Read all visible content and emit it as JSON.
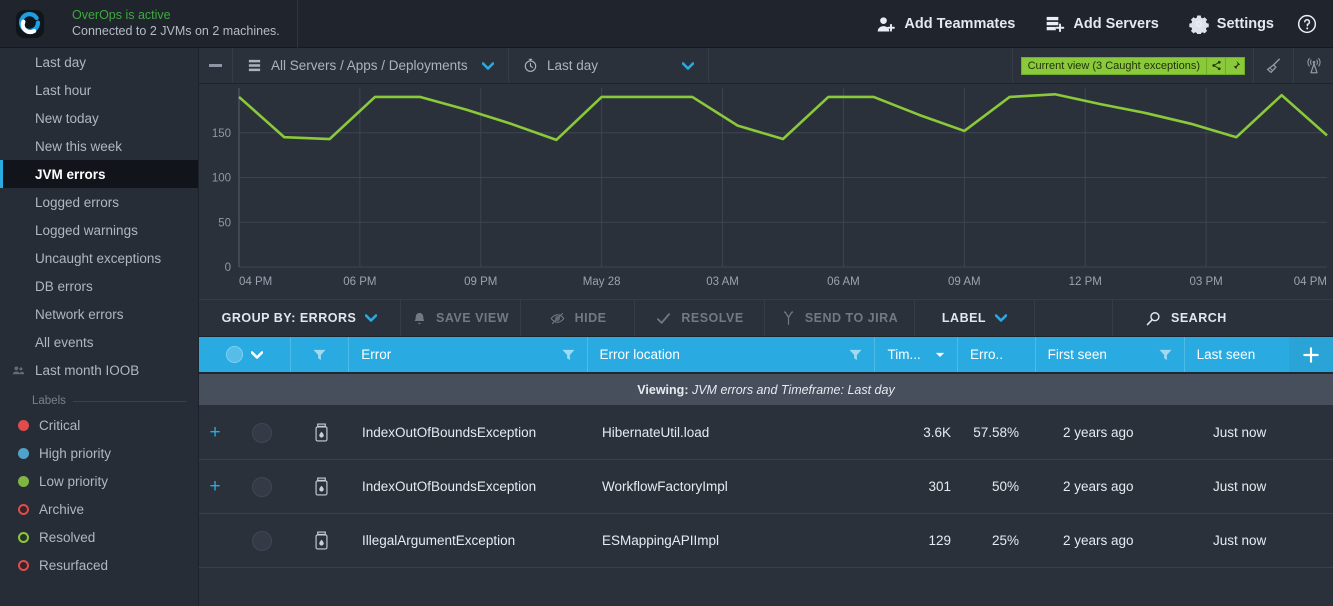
{
  "topbar": {
    "logo": "overops-logo",
    "status_title": "OverOps is active",
    "status_sub": "Connected to 2 JVMs on 2 machines.",
    "actions": [
      {
        "label": "Add Teammates",
        "icon": "add-user-icon"
      },
      {
        "label": "Add Servers",
        "icon": "add-server-icon"
      },
      {
        "label": "Settings",
        "icon": "gear-icon"
      }
    ],
    "help_icon": "help-icon"
  },
  "sidebar": {
    "items": [
      {
        "label": "Last day",
        "active": false
      },
      {
        "label": "Last hour",
        "active": false
      },
      {
        "label": "New today",
        "active": false
      },
      {
        "label": "New this week",
        "active": false
      },
      {
        "label": "JVM errors",
        "active": true
      },
      {
        "label": "Logged errors",
        "active": false
      },
      {
        "label": "Logged warnings",
        "active": false
      },
      {
        "label": "Uncaught exceptions",
        "active": false
      },
      {
        "label": "DB errors",
        "active": false
      },
      {
        "label": "Network errors",
        "active": false
      },
      {
        "label": "All events",
        "active": false
      },
      {
        "label": "Last month IOOB",
        "active": false,
        "icon": "people-icon"
      }
    ],
    "labels_header": "Labels",
    "labels": [
      {
        "label": "Critical",
        "color": "#e14b4b",
        "filled": true
      },
      {
        "label": "High priority",
        "color": "#4ea3c9",
        "filled": true
      },
      {
        "label": "Low priority",
        "color": "#7fb63f",
        "filled": true
      },
      {
        "label": "Archive",
        "color": "#e14b4b",
        "filled": false
      },
      {
        "label": "Resolved",
        "color": "#8ac93a",
        "filled": false
      },
      {
        "label": "Resurfaced",
        "color": "#e14b4b",
        "filled": false
      }
    ]
  },
  "filterbar": {
    "collapse_icon": "minus-icon",
    "servers_label": "All Servers / Apps / Deployments",
    "servers_icon": "servers-icon",
    "time_label": "Last day",
    "time_icon": "clock-icon",
    "current_view": "Current view (3 Caught exceptions)",
    "current_view_color": "#8ac93a",
    "share_icon": "share-icon",
    "pin_icon": "pin-icon",
    "broom_icon": "broom-icon",
    "antenna_icon": "antenna-icon"
  },
  "chart_data": {
    "type": "line",
    "title": "",
    "xlabel": "",
    "ylabel": "",
    "ylim": [
      0,
      200
    ],
    "yticks": [
      0,
      50,
      100,
      150
    ],
    "grid": true,
    "legend": "none",
    "line_color": "#8ac93a",
    "xticks": [
      "04 PM",
      "06 PM",
      "09 PM",
      "May 28",
      "03 AM",
      "06 AM",
      "09 AM",
      "12 PM",
      "03 PM",
      "04 PM"
    ],
    "x": [
      "04 PM",
      "05 PM",
      "06 PM",
      "07 PM",
      "08 PM",
      "09 PM",
      "10 PM",
      "11 PM",
      "12 AM",
      "01 AM",
      "02 AM",
      "03 AM",
      "04 AM",
      "05 AM",
      "06 AM",
      "07 AM",
      "08 AM",
      "09 AM",
      "10 AM",
      "11 AM",
      "12 PM",
      "01 PM",
      "02 PM",
      "03 PM",
      "04 PM"
    ],
    "values": [
      190,
      145,
      143,
      190,
      190,
      176,
      160,
      142,
      190,
      190,
      190,
      158,
      143,
      190,
      190,
      170,
      152,
      190,
      193,
      182,
      172,
      160,
      145,
      192,
      147
    ]
  },
  "actionbar": {
    "group_by": "GROUP BY: ERRORS",
    "save_view": "SAVE VIEW",
    "hide": "HIDE",
    "resolve": "RESOLVE",
    "send_to_jira": "SEND TO JIRA",
    "label": "LABEL",
    "search": "SEARCH",
    "icons": {
      "bell": "bell-icon",
      "eye_off": "eye-off-icon",
      "check": "check-icon",
      "jira": "jira-icon",
      "search": "search-icon"
    }
  },
  "table": {
    "columns": {
      "select": "",
      "filter": "",
      "error": "Error",
      "error_location": "Error location",
      "times": "Tim...",
      "error_rate": "Erro..",
      "first_seen": "First seen",
      "last_seen": "Last seen",
      "add": "+"
    },
    "viewing_prefix": "Viewing",
    "viewing_text": "JVM errors and Timeframe: Last day",
    "rows": [
      {
        "expandable": true,
        "icon": "jar-icon",
        "error": "IndexOutOfBoundsException",
        "error_location": "HibernateUtil.load",
        "times": "3.6K",
        "error_rate": "57.58%",
        "first_seen": "2 years ago",
        "last_seen": "Just now"
      },
      {
        "expandable": true,
        "icon": "jar-icon",
        "error": "IndexOutOfBoundsException",
        "error_location": "WorkflowFactoryImpl",
        "times": "301",
        "error_rate": "50%",
        "first_seen": "2 years ago",
        "last_seen": "Just now"
      },
      {
        "expandable": false,
        "icon": "jar-icon",
        "error": "IllegalArgumentException",
        "error_location": "ESMappingAPIImpl",
        "times": "129",
        "error_rate": "25%",
        "first_seen": "2 years ago",
        "last_seen": "Just now"
      }
    ]
  },
  "colors": {
    "accent_blue": "#29abe2",
    "accent_green": "#8ac93a",
    "bg_dark": "#2b313b",
    "bg_darker": "#1f242d",
    "sidebar": "#272d37"
  }
}
